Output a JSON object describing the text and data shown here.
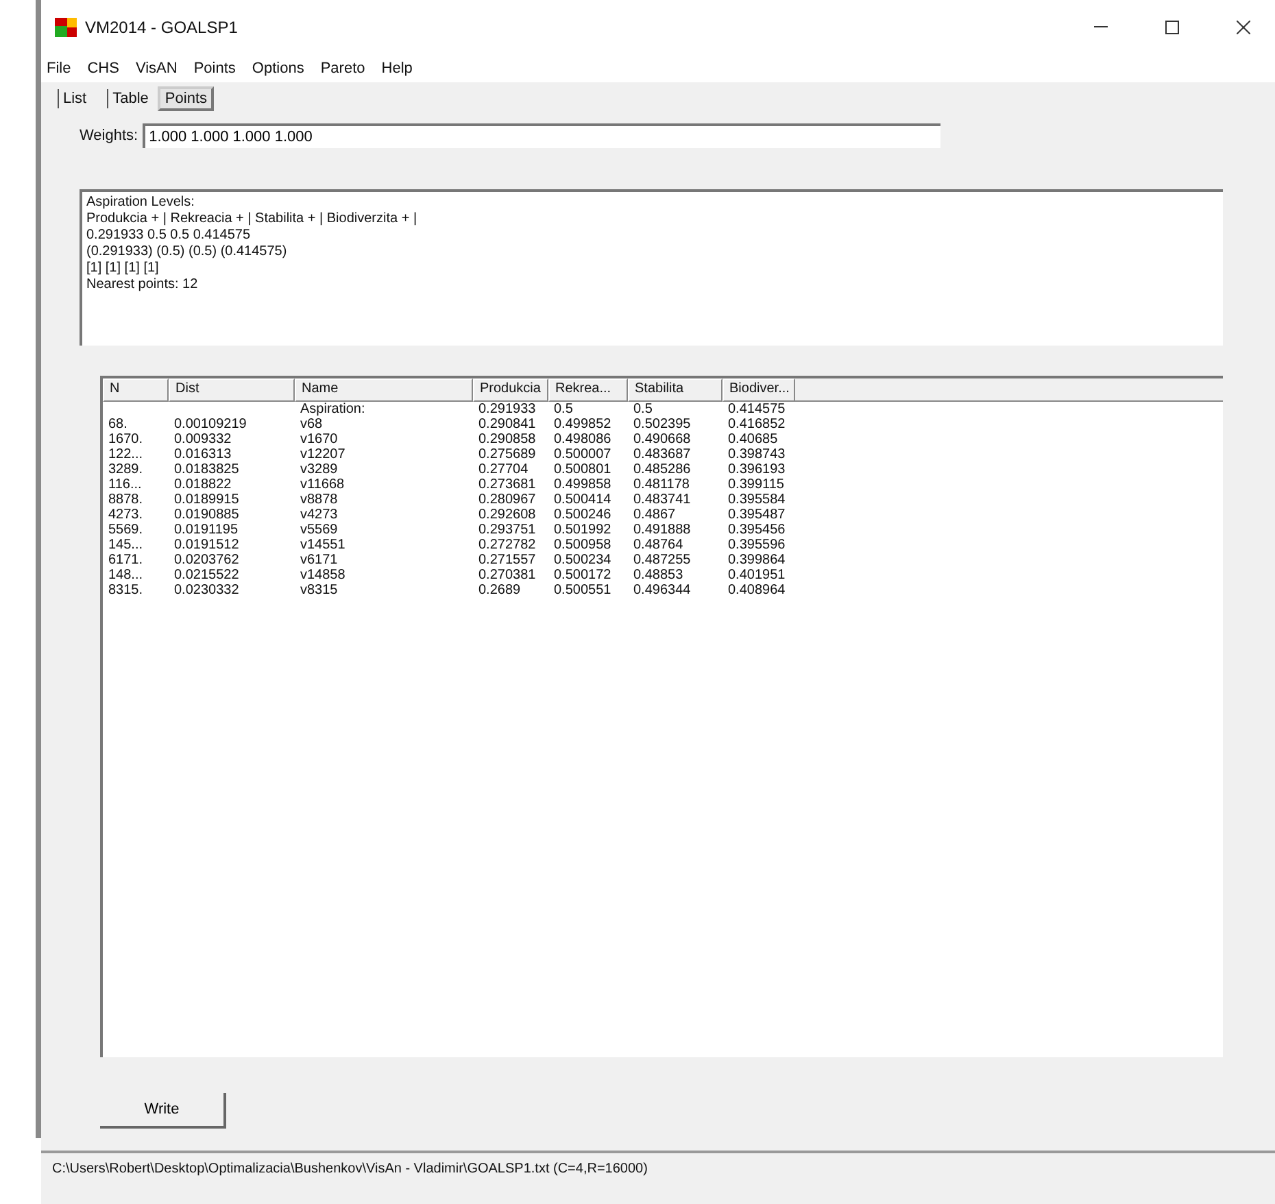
{
  "window": {
    "title": "VM2014 - GOALSP1"
  },
  "menu": [
    "File",
    "CHS",
    "VisAN",
    "Points",
    "Options",
    "Pareto",
    "Help"
  ],
  "tabs": [
    {
      "label": "List",
      "selected": false
    },
    {
      "label": "Table",
      "selected": false
    },
    {
      "label": "Points",
      "selected": true
    }
  ],
  "weights": {
    "label": "Weights:",
    "value": "1.000 1.000 1.000 1.000"
  },
  "aspiration_text": [
    "Aspiration Levels:",
    "Produkcia + | Rekreacia + | Stabilita  + | Biodiverzita + |",
    "0.291933 0.5 0.5 0.414575",
    "(0.291933) (0.5) (0.5) (0.414575)",
    "[1] [1] [1] [1]",
    "Nearest points: 12"
  ],
  "table": {
    "columns": [
      "N",
      "Dist",
      "Name",
      "Produkcia",
      "Rekrea...",
      "Stabilita",
      "Biodiver..."
    ],
    "rows": [
      [
        "",
        "",
        "Aspiration:",
        "0.291933",
        "0.5",
        "0.5",
        "0.414575"
      ],
      [
        "68.",
        "0.00109219",
        "v68",
        "0.290841",
        "0.499852",
        "0.502395",
        "0.416852"
      ],
      [
        "1670.",
        "0.009332",
        "v1670",
        "0.290858",
        "0.498086",
        "0.490668",
        "0.40685"
      ],
      [
        "122...",
        "0.016313",
        "v12207",
        "0.275689",
        "0.500007",
        "0.483687",
        "0.398743"
      ],
      [
        "3289.",
        "0.0183825",
        "v3289",
        "0.27704",
        "0.500801",
        "0.485286",
        "0.396193"
      ],
      [
        "116...",
        "0.018822",
        "v11668",
        "0.273681",
        "0.499858",
        "0.481178",
        "0.399115"
      ],
      [
        "8878.",
        "0.0189915",
        "v8878",
        "0.280967",
        "0.500414",
        "0.483741",
        "0.395584"
      ],
      [
        "4273.",
        "0.0190885",
        "v4273",
        "0.292608",
        "0.500246",
        "0.4867",
        "0.395487"
      ],
      [
        "5569.",
        "0.0191195",
        "v5569",
        "0.293751",
        "0.501992",
        "0.491888",
        "0.395456"
      ],
      [
        "145...",
        "0.0191512",
        "v14551",
        "0.272782",
        "0.500958",
        "0.48764",
        "0.395596"
      ],
      [
        "6171.",
        "0.0203762",
        "v6171",
        "0.271557",
        "0.500234",
        "0.487255",
        "0.399864"
      ],
      [
        "148...",
        "0.0215522",
        "v14858",
        "0.270381",
        "0.500172",
        "0.48853",
        "0.401951"
      ],
      [
        "8315.",
        "0.0230332",
        "v8315",
        "0.2689",
        "0.500551",
        "0.496344",
        "0.408964"
      ]
    ]
  },
  "write_button": "Write",
  "status_bar": "C:\\Users\\Robert\\Desktop\\Optimalizacia\\Bushenkov\\VisAn - Vladimir\\GOALSP1.txt    (C=4,R=16000)"
}
